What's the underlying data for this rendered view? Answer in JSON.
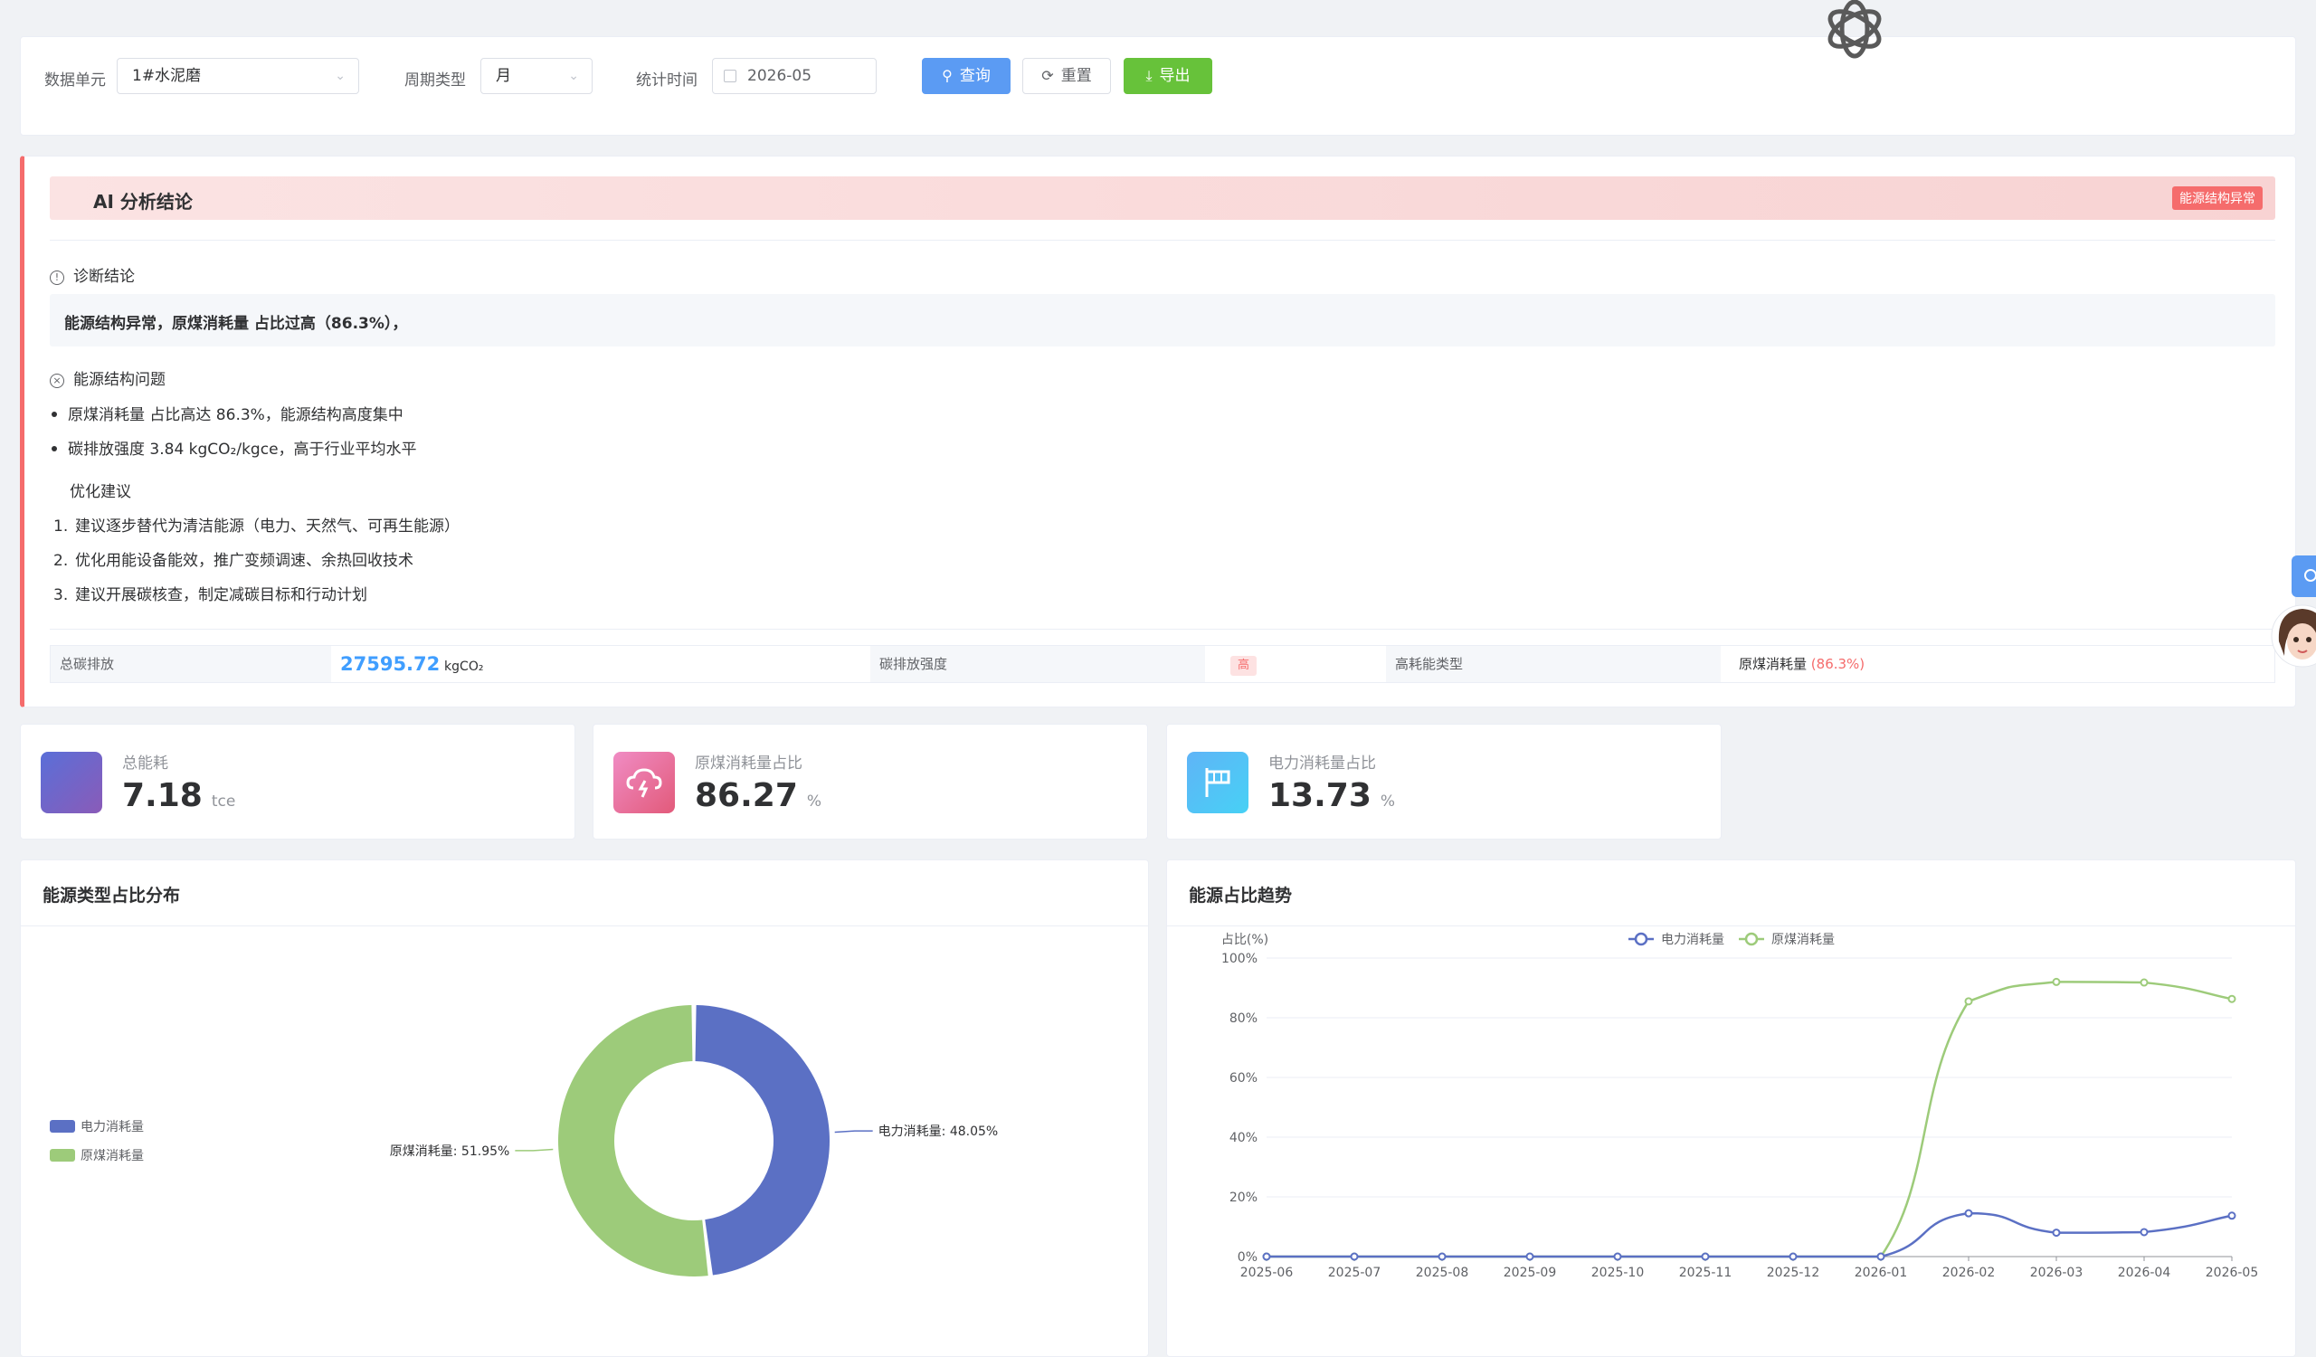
{
  "filter": {
    "unit_label": "数据单元",
    "unit_value": "1#水泥磨",
    "period_label": "周期类型",
    "period_value": "月",
    "time_label": "统计时间",
    "time_value": "2026-05",
    "query_label": "查询",
    "reset_label": "重置",
    "export_label": "导出"
  },
  "ai": {
    "title": "AI 分析结论",
    "badge": "能源结构异常",
    "diag_head": "诊断结论",
    "diag_text": "能源结构异常，原煤消耗量 占比过高（86.3%），",
    "issues_head": "能源结构问题",
    "issues": [
      "原煤消耗量 占比高达 86.3%，能源结构高度集中",
      "碳排放强度 3.84 kgCO₂/kgce，高于行业平均水平"
    ],
    "sug_head": "优化建议",
    "suggestions": [
      {
        "num": "1.",
        "text": "建议逐步替代为清洁能源（电力、天然气、可再生能源）"
      },
      {
        "num": "2.",
        "text": "优化用能设备能效，推广变频调速、余热回收技术"
      },
      {
        "num": "3.",
        "text": "建议开展碳核查，制定减碳目标和行动计划"
      }
    ],
    "metrics": {
      "total_label": "总碳排放",
      "total_value": "27595.72",
      "total_unit": "kgCO₂",
      "intensity_label": "碳排放强度",
      "intensity_value": "高",
      "type_label": "高耗能类型",
      "type_value": "原煤消耗量",
      "type_pct": "(86.3%)"
    }
  },
  "stats": [
    {
      "label": "总能耗",
      "value": "7.18",
      "unit": "tce",
      "icon": "energy-cube-icon",
      "color": "#6f63c9"
    },
    {
      "label": "原煤消耗量占比",
      "value": "86.27",
      "unit": "%",
      "icon": "cloud-lightning-icon",
      "color": "#e56ea0"
    },
    {
      "label": "电力消耗量占比",
      "value": "13.73",
      "unit": "%",
      "icon": "flag-icon",
      "color": "#4aa8ee"
    }
  ],
  "pie_panel": {
    "title": "能源类型占比分布",
    "legend": [
      "电力消耗量",
      "原煤消耗量"
    ]
  },
  "trend_panel": {
    "title": "能源占比趋势"
  },
  "chart_data": [
    {
      "type": "pie",
      "title": "能源类型占比分布",
      "slices": [
        {
          "name": "电力消耗量",
          "value": 48.05,
          "label": "电力消耗量: 48.05%",
          "color": "#5b70c4"
        },
        {
          "name": "原煤消耗量",
          "value": 51.95,
          "label": "原煤消耗量: 51.95%",
          "color": "#9dcb7a"
        }
      ],
      "donut": true,
      "legend": "left"
    },
    {
      "type": "line",
      "title": "能源占比趋势",
      "ylabel": "占比(%)",
      "ylim": [
        0,
        100
      ],
      "yticks": [
        "0%",
        "20%",
        "40%",
        "60%",
        "80%",
        "100%"
      ],
      "categories": [
        "2025-06",
        "2025-07",
        "2025-08",
        "2025-09",
        "2025-10",
        "2025-11",
        "2025-12",
        "2026-01",
        "2026-02",
        "2026-03",
        "2026-04",
        "2026-05"
      ],
      "series": [
        {
          "name": "电力消耗量",
          "color": "#5b70c4",
          "values": [
            0,
            0,
            0,
            0,
            0,
            0,
            0,
            0,
            14.5,
            8,
            8.2,
            13.7
          ]
        },
        {
          "name": "原煤消耗量",
          "color": "#9dcb7a",
          "values": [
            0,
            0,
            0,
            0,
            0,
            0,
            0,
            0,
            85.5,
            92,
            91.8,
            86.3
          ]
        }
      ],
      "grid": true,
      "legend": "top-center"
    }
  ]
}
